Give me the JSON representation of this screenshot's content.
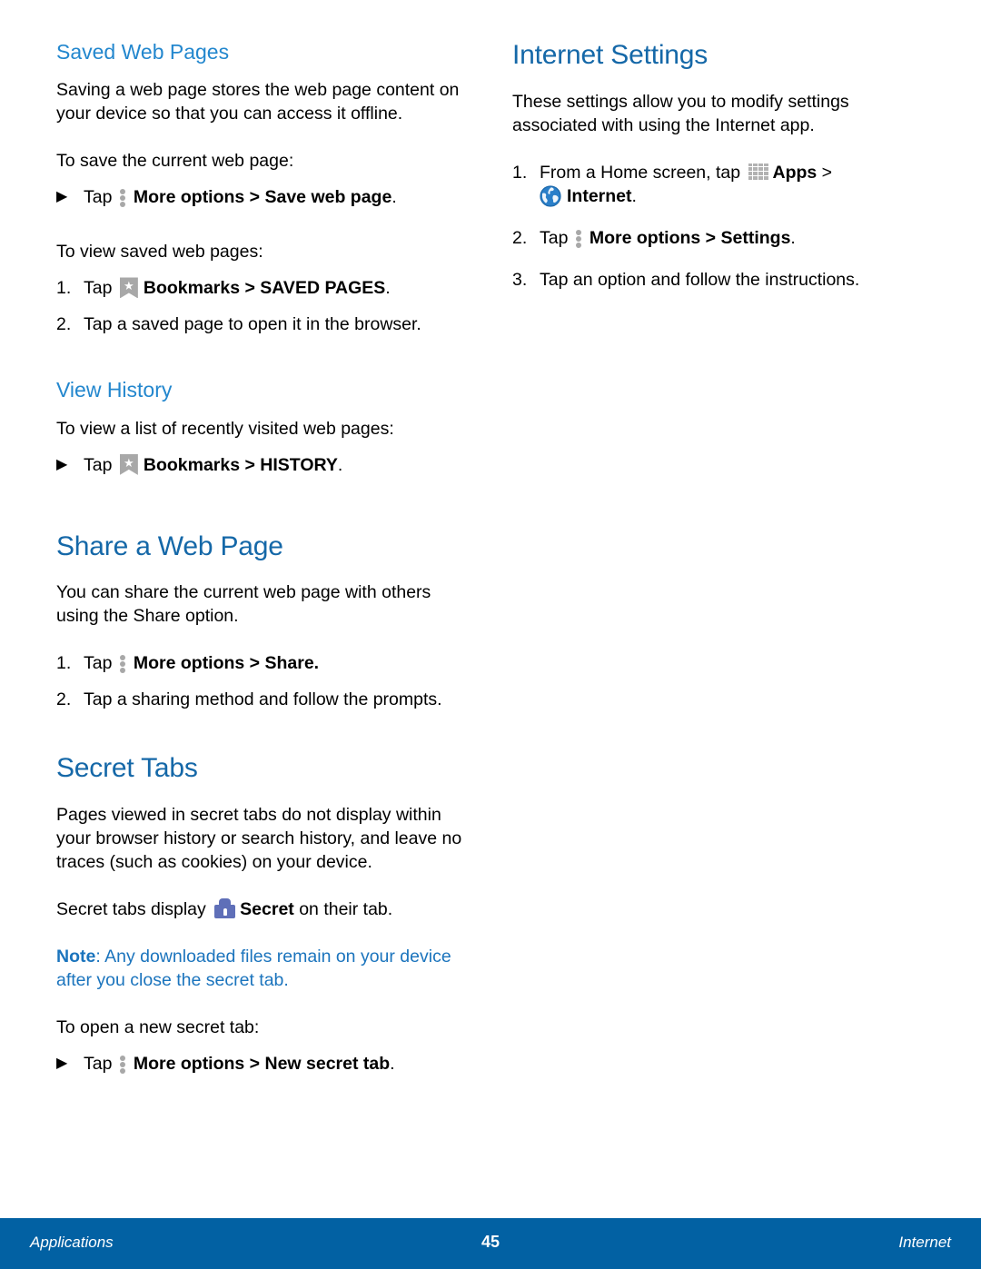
{
  "colors": {
    "h1_blue": "#1568a8",
    "h2_blue": "#2387ce",
    "note_blue": "#1b74bd",
    "footer_bg": "#0261a3",
    "icon_gray": "#a8a8a8",
    "secret_purple": "#5f6fb8",
    "globe_blue": "#2a7fc9"
  },
  "left_column": {
    "saved_web_pages": {
      "heading": "Saved Web Pages",
      "intro": "Saving a web page stores the web page content on your device so that you can access it offline.",
      "lead_in_1": "To save the current web page:",
      "bullet_1": {
        "marker": "▶",
        "prefix": "Tap ",
        "icon": "more-options-icon",
        "bold": "More options > Save web page",
        "suffix": "."
      },
      "lead_in_2": "To view saved web pages:",
      "steps": [
        {
          "marker": "1.",
          "prefix": "Tap ",
          "icon": "bookmarks-icon",
          "bold": "Bookmarks > SAVED PAGES",
          "suffix": "."
        },
        {
          "marker": "2.",
          "prefix": "Tap a saved page to open it in the browser.",
          "icon": "",
          "bold": "",
          "suffix": ""
        }
      ]
    },
    "view_history": {
      "heading": "View History",
      "lead_in": "To view a list of recently visited web pages:",
      "bullet": {
        "marker": "▶",
        "prefix": "Tap ",
        "icon": "bookmarks-icon",
        "bold": "Bookmarks > HISTORY",
        "suffix": "."
      }
    },
    "share_a_web_page": {
      "heading": "Share a Web Page",
      "intro": "You can share the current web page with others using the Share option.",
      "steps": [
        {
          "marker": "1.",
          "prefix": "Tap ",
          "icon": "more-options-icon",
          "bold": "More options > Share.",
          "suffix": ""
        },
        {
          "marker": "2.",
          "prefix": "Tap a sharing method and follow the prompts.",
          "icon": "",
          "bold": "",
          "suffix": ""
        }
      ]
    },
    "secret_tabs": {
      "heading": "Secret Tabs",
      "intro": "Pages viewed in secret tabs do not display within your browser history or search history, and leave no traces (such as cookies) on your device.",
      "display_line": {
        "prefix": "Secret tabs display ",
        "icon": "secret-lock-icon",
        "bold": "Secret",
        "suffix": " on their tab."
      },
      "note": {
        "label": "Note",
        "text": ": Any downloaded files remain on your device after you close the secret tab."
      },
      "lead_in": "To open a new secret tab:",
      "bullet": {
        "marker": "▶",
        "prefix": "Tap ",
        "icon": "more-options-icon",
        "bold": "More options > New secret tab",
        "suffix": "."
      }
    }
  },
  "right_column": {
    "internet_settings": {
      "heading": "Internet Settings",
      "intro": "These settings allow you to modify settings associated with using the Internet app.",
      "step1": {
        "marker": "1.",
        "prefix": "From a Home screen, tap ",
        "apps_icon": "apps-icon",
        "apps_bold": "Apps",
        "arrow": " > ",
        "globe_icon": "internet-globe-icon",
        "internet_bold": "Internet",
        "suffix": "."
      },
      "step2": {
        "marker": "2.",
        "prefix": "Tap ",
        "icon": "more-options-icon",
        "bold": "More options > Settings",
        "suffix": "."
      },
      "step3": {
        "marker": "3.",
        "prefix": "Tap an option and follow the instructions."
      }
    }
  },
  "footer": {
    "left": "Applications",
    "page_number": "45",
    "right": "Internet"
  }
}
